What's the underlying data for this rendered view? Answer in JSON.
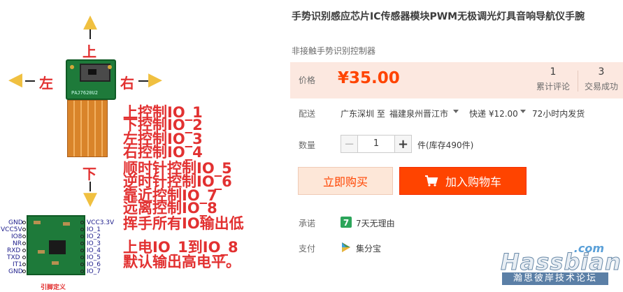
{
  "product_image": {
    "directions": {
      "up": "上",
      "down": "下",
      "left": "左",
      "right": "右"
    },
    "sensor_label": "PAJ7620U2",
    "control_lines": [
      "上控制IO_1",
      "下控制IO_2",
      "左控制IO_3",
      "右控制IO_4",
      "顺时针控制IO_5",
      "逆时针控制IO_6",
      "靠近控制IO_7",
      "远离控制IO_8",
      "挥手所有IO输出低"
    ],
    "power_lines": [
      "上电IO_1到IO_8",
      "默认输出高电平。"
    ],
    "pins_left": [
      "GND",
      "VCC5V",
      "IO8",
      "NR",
      "RXD",
      "TXD",
      "IT1",
      "GND"
    ],
    "pins_right": [
      "VCC3.3V",
      "IO_1",
      "IO_2",
      "IO_3",
      "IO_4",
      "IO_5",
      "IO_6",
      "IO_7"
    ],
    "pin_caption": "引脚定义"
  },
  "product": {
    "title": "手势识别感应芯片IC传感器模块PWM无极调光灯具音响导航仪手腕",
    "subtitle": "非接触手势识别控制器",
    "price_label": "价格",
    "price": "¥35.00",
    "stats": [
      {
        "num": "1",
        "label": "累计评论"
      },
      {
        "num": "3",
        "label": "交易成功"
      }
    ],
    "shipping": {
      "label": "配送",
      "from": "广东深圳 至",
      "to": "福建泉州晋江市",
      "express": "快递 ¥12.00",
      "dispatch": "72小时内发货"
    },
    "quantity": {
      "label": "数量",
      "value": "1",
      "stock": "件(库存490件)"
    },
    "buttons": {
      "buy": "立即购买",
      "cart": "加入购物车"
    },
    "promise": {
      "label": "承诺",
      "text": "7天无理由",
      "icon_text": "7"
    },
    "payment": {
      "label": "支付",
      "text": "集分宝"
    }
  },
  "watermark": {
    "com": ".com",
    "main": "Hassbian",
    "sub": "瀚思彼岸技术论坛"
  },
  "colors": {
    "accent": "#ff4400",
    "price_bg": "#fce8e0",
    "promise_green": "#2ca55a"
  }
}
